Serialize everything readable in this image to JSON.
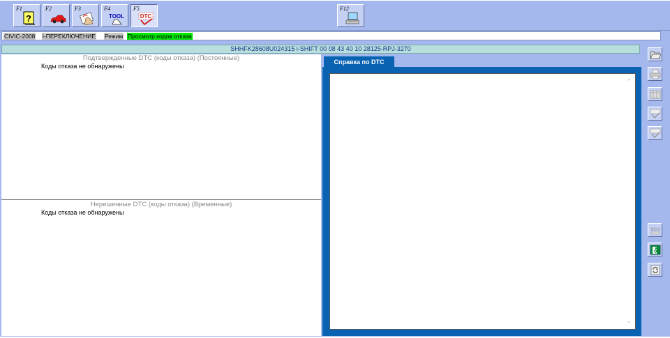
{
  "toolbar": {
    "keys": [
      {
        "key": "F1",
        "icon": "help-icon"
      },
      {
        "key": "F2",
        "icon": "car-icon"
      },
      {
        "key": "F3",
        "icon": "hand-icon"
      },
      {
        "key": "F4",
        "icon": "tool-icon",
        "text": "TOOL"
      },
      {
        "key": "F5",
        "icon": "dtc-icon",
        "text": "DTC"
      },
      {
        "key": "F12",
        "icon": "computer-icon"
      }
    ]
  },
  "info": {
    "model": "CIVIC-2008",
    "system": "i-ПЕРЕКЛЮЧЕНИЕ",
    "mode_label": "Режим",
    "mode_value": "Просмотр кодов отказа"
  },
  "vin_bar": "SHHFK28608U024315  i-SHIFT  00 08 43 40 10  28125-RPJ-3270",
  "panels": {
    "confirmed": {
      "title": "Подтвержденные DTC (коды отказа) (Постоянные)",
      "message": "Коды отказа не обнаружены"
    },
    "pending": {
      "title": "Нерешенные DTC (коды отказа) (Временные)",
      "message": "Коды отказа не обнаружены"
    }
  },
  "help": {
    "tab_label": "Справка по DTC"
  },
  "side_buttons": [
    {
      "icon": "open-folder-icon",
      "enabled": true
    },
    {
      "icon": "print-icon",
      "enabled": false
    },
    {
      "icon": "table-icon",
      "enabled": false
    },
    {
      "icon": "scs-check-icon",
      "enabled": false
    },
    {
      "icon": "dtc-check-icon",
      "enabled": false
    },
    {
      "icon": "scs-icon",
      "text": "SCS",
      "enabled": false
    },
    {
      "icon": "exit-icon",
      "enabled": true
    },
    {
      "icon": "refresh-icon",
      "enabled": true
    }
  ],
  "colors": {
    "background": "#a4b8ee",
    "help_frame": "#0a62b3",
    "mode_highlight": "#00e600",
    "vin_bar": "#b8dede"
  }
}
